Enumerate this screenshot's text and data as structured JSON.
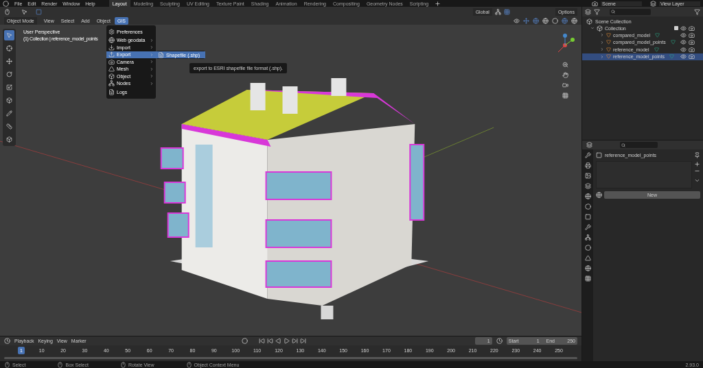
{
  "menubar": {
    "items": [
      "File",
      "Edit",
      "Render",
      "Window",
      "Help"
    ]
  },
  "workspace_tabs": [
    {
      "label": "Layout",
      "selected": true
    },
    {
      "label": "Modeling",
      "selected": false
    },
    {
      "label": "Sculpting",
      "selected": false
    },
    {
      "label": "UV Editing",
      "selected": false
    },
    {
      "label": "Texture Paint",
      "selected": false
    },
    {
      "label": "Shading",
      "selected": false
    },
    {
      "label": "Animation",
      "selected": false
    },
    {
      "label": "Rendering",
      "selected": false
    },
    {
      "label": "Compositing",
      "selected": false
    },
    {
      "label": "Geometry Nodes",
      "selected": false
    },
    {
      "label": "Scripting",
      "selected": false
    }
  ],
  "scene": {
    "scene": "Scene",
    "view_layer": "View Layer"
  },
  "tool_header": {
    "orientation": "Global",
    "options": "Options"
  },
  "viewport_header": {
    "mode": "Object Mode",
    "menus": [
      {
        "label": "View",
        "selected": false
      },
      {
        "label": "Select",
        "selected": false
      },
      {
        "label": "Add",
        "selected": false
      },
      {
        "label": "Object",
        "selected": false
      },
      {
        "label": "GIS",
        "selected": true
      }
    ]
  },
  "viewport": {
    "perspective": "User Perspective",
    "context": "(1) Collection | reference_model_points"
  },
  "gis_menu": {
    "items": [
      {
        "label": "Preferences",
        "kind": "item",
        "selected": false
      },
      {
        "label": "Web geodata",
        "kind": "submenu",
        "selected": false
      },
      {
        "label": "Import",
        "kind": "submenu",
        "selected": false
      },
      {
        "label": "Export",
        "kind": "submenu",
        "selected": true
      },
      {
        "label": "Camera",
        "kind": "submenu",
        "selected": false
      },
      {
        "label": "Mesh",
        "kind": "submenu",
        "selected": false
      },
      {
        "label": "Object",
        "kind": "submenu",
        "selected": false
      },
      {
        "label": "Nodes",
        "kind": "submenu",
        "selected": false
      },
      {
        "label": "Logs",
        "kind": "item",
        "selected": false
      }
    ]
  },
  "export_submenu": {
    "items": [
      {
        "label": "Shapefile (.shp)",
        "selected": true
      }
    ]
  },
  "tooltip": "export to ESRI shapefile file format (.shp).",
  "outliner": {
    "root": "Scene Collection",
    "collection": {
      "label": "Collection",
      "checked": true,
      "expanded": true,
      "children": [
        {
          "label": "compared_model",
          "selected": false
        },
        {
          "label": "compared_model_points",
          "selected": false
        },
        {
          "label": "reference_model",
          "selected": false
        },
        {
          "label": "reference_model_points",
          "selected": true
        }
      ]
    }
  },
  "properties": {
    "object": "reference_model_points",
    "new_button": "New"
  },
  "timeline": {
    "menus": [
      "Playback",
      "Keying",
      "View",
      "Marker"
    ],
    "current_frame": "1",
    "start_label": "Start",
    "start": "1",
    "end_label": "End",
    "end": "250",
    "playhead": "1",
    "ticks": [
      "10",
      "20",
      "30",
      "40",
      "50",
      "60",
      "70",
      "80",
      "90",
      "100",
      "110",
      "120",
      "130",
      "140",
      "150",
      "160",
      "170",
      "180",
      "190",
      "200",
      "210",
      "220",
      "230",
      "240",
      "250"
    ]
  },
  "status_bar": {
    "items": [
      "Select",
      "Box Select",
      "Rotate View",
      "Object Context Menu"
    ],
    "version": "2.93.0"
  }
}
